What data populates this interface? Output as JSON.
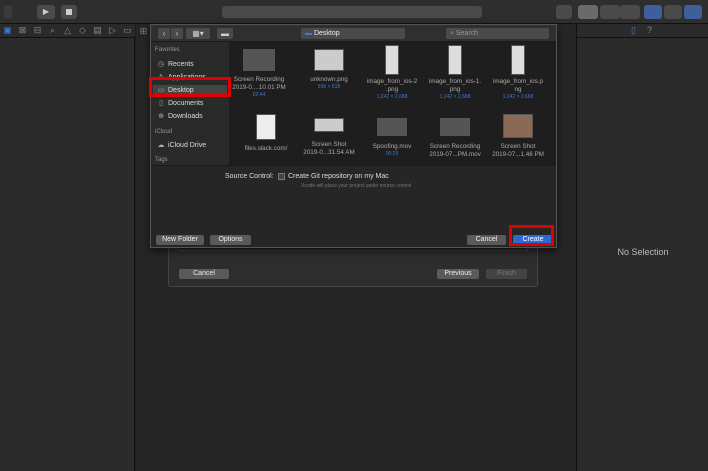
{
  "app": {
    "toolbar_title": ""
  },
  "sheet": {
    "location": "Desktop",
    "search_placeholder": "Search",
    "sidebar": {
      "favorites_heading": "Favorites",
      "favorites": [
        {
          "label": "Recents",
          "icon": "clock-icon"
        },
        {
          "label": "Applications",
          "icon": "applications-icon"
        },
        {
          "label": "Desktop",
          "icon": "desktop-icon",
          "selected": true
        },
        {
          "label": "Documents",
          "icon": "document-icon"
        },
        {
          "label": "Downloads",
          "icon": "download-icon"
        }
      ],
      "icloud_heading": "iCloud",
      "icloud": [
        {
          "label": "iCloud Drive",
          "icon": "cloud-icon"
        }
      ],
      "tags_heading": "Tags"
    },
    "files": [
      {
        "name": "Screen Recording",
        "name2": "2019-0....10.01 PM",
        "meta": "02:44"
      },
      {
        "name": "unknown.png",
        "name2": "",
        "meta": "936 × 618"
      },
      {
        "name": "image_from_ios-2",
        "name2": ".png",
        "meta": "1,242 × 2,688"
      },
      {
        "name": "image_from_ios-1.",
        "name2": "png",
        "meta": "1,242 × 2,688"
      },
      {
        "name": "image_from_ios.p",
        "name2": "ng",
        "meta": "1,242 × 2,688"
      },
      {
        "name": "files.slack.com/",
        "name2": "",
        "meta": ""
      },
      {
        "name": "Screen Shot",
        "name2": "2019-0...31.54 AM",
        "meta": ""
      },
      {
        "name": "Spoofing.mov",
        "name2": "",
        "meta": "00:29"
      },
      {
        "name": "Screen Recording",
        "name2": "2019-07...PM.mov",
        "meta": ""
      },
      {
        "name": "Screen Shot",
        "name2": "2019-07...1.46 PM",
        "meta": ""
      }
    ],
    "source_control_label": "Source Control:",
    "git_checkbox_label": "Create Git repository on my Mac",
    "git_subtext": "Xcode will place your project under source control",
    "new_folder": "New Folder",
    "options": "Options",
    "cancel": "Cancel",
    "create": "Create"
  },
  "wizard": {
    "cancel": "Cancel",
    "previous": "Previous",
    "finish": "Finish"
  },
  "inspector": {
    "no_selection": "No Selection"
  },
  "colors": {
    "highlight": "#e00000",
    "accent": "#2a6ad8"
  }
}
